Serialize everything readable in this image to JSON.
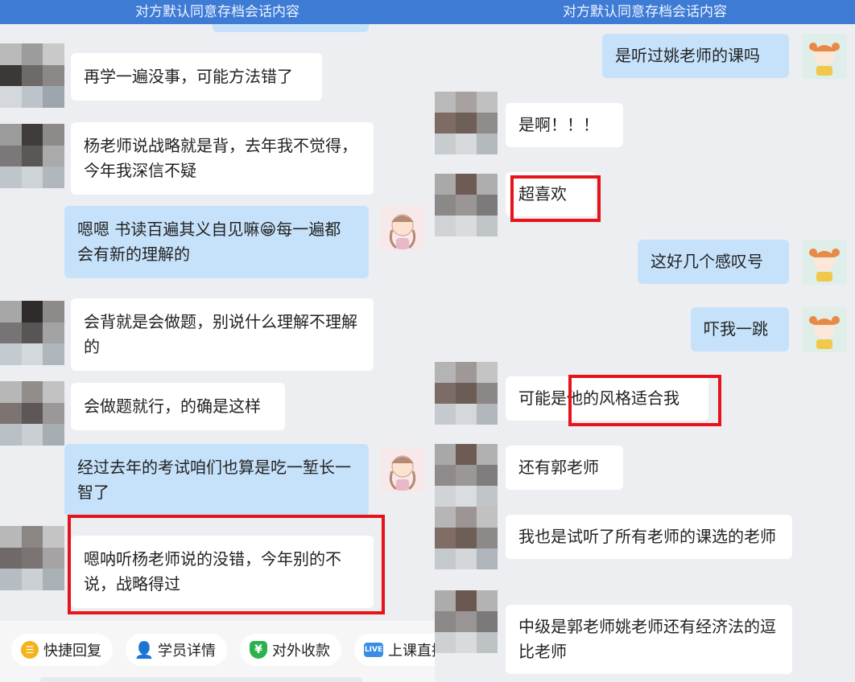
{
  "banner_text": "对方默认同意存档会话内容",
  "left_panel": {
    "messages": [
      {
        "text": "再学一遍没事，可能方法错了"
      },
      {
        "text": "杨老师说战略就是背，去年我不觉得，今年我深信不疑"
      },
      {
        "text": "嗯嗯 书读百遍其义自见嘛😁每一遍都会有新的理解的"
      },
      {
        "text": "会背就是会做题，别说什么理解不理解的"
      },
      {
        "text": "会做题就行，的确是这样"
      },
      {
        "text": "经过去年的考试咱们也算是吃一堑长一智了"
      },
      {
        "text": "嗯呐听杨老师说的没错，今年别的不说，战略得过"
      }
    ],
    "quick_actions": [
      {
        "label": "快捷回复",
        "icon": "quick-reply-icon"
      },
      {
        "label": "学员详情",
        "icon": "student-detail-icon"
      },
      {
        "label": "对外收款",
        "icon": "payment-icon"
      },
      {
        "label": "上课直播",
        "icon": "live-icon"
      }
    ]
  },
  "right_panel": {
    "messages": [
      {
        "text": "是听过姚老师的课吗"
      },
      {
        "text": "是啊！！！"
      },
      {
        "text": "超喜欢"
      },
      {
        "text": "这好几个感叹号"
      },
      {
        "text": "吓我一跳"
      },
      {
        "text": "可能是他的风格适合我"
      },
      {
        "text": "还有郭老师"
      },
      {
        "text": "我也是试听了所有老师的课选的老师"
      },
      {
        "text": "中级是郭老师姚老师还有经济法的逗比老师"
      }
    ]
  },
  "colors": {
    "banner": "#3e7bd5",
    "outgoing_bubble": "#c6e2fb",
    "incoming_bubble": "#ffffff",
    "highlight_box": "#e8131a",
    "background": "#eceef2"
  }
}
